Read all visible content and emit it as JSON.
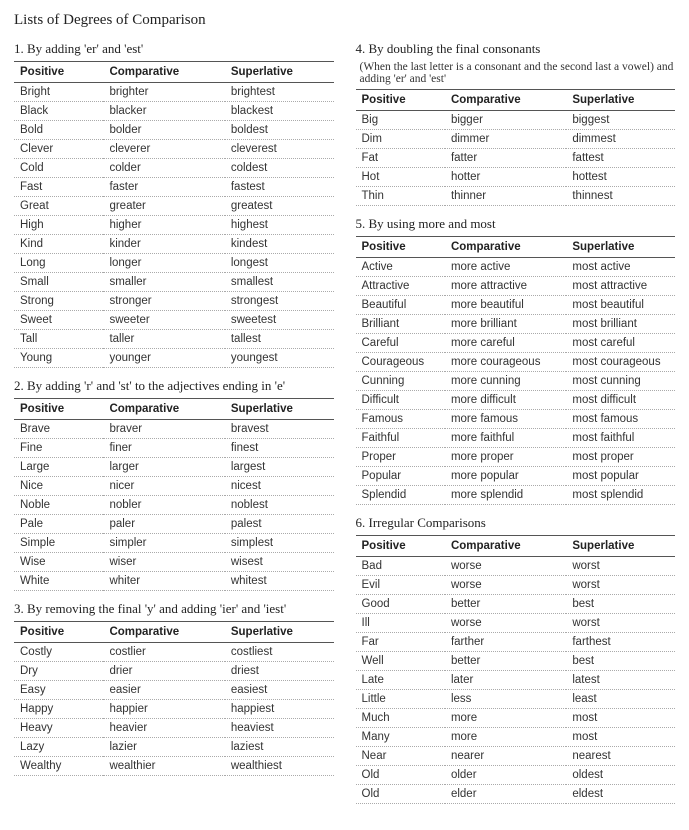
{
  "page_title": "Lists of Degrees of Comparison",
  "columns_header": {
    "positive": "Positive",
    "comparative": "Comparative",
    "superlative": "Superlative"
  },
  "sections": [
    {
      "heading": "1. By adding 'er' and 'est'",
      "rows": [
        [
          "Bright",
          "brighter",
          "brightest"
        ],
        [
          "Black",
          "blacker",
          "blackest"
        ],
        [
          "Bold",
          "bolder",
          "boldest"
        ],
        [
          "Clever",
          "cleverer",
          "cleverest"
        ],
        [
          "Cold",
          "colder",
          "coldest"
        ],
        [
          "Fast",
          "faster",
          "fastest"
        ],
        [
          "Great",
          "greater",
          "greatest"
        ],
        [
          "High",
          "higher",
          "highest"
        ],
        [
          "Kind",
          "kinder",
          "kindest"
        ],
        [
          "Long",
          "longer",
          "longest"
        ],
        [
          "Small",
          "smaller",
          "smallest"
        ],
        [
          "Strong",
          "stronger",
          "strongest"
        ],
        [
          "Sweet",
          "sweeter",
          "sweetest"
        ],
        [
          "Tall",
          "taller",
          "tallest"
        ],
        [
          "Young",
          "younger",
          "youngest"
        ]
      ]
    },
    {
      "heading": "2. By adding 'r' and 'st' to the adjectives ending in 'e'",
      "rows": [
        [
          "Brave",
          "braver",
          "bravest"
        ],
        [
          "Fine",
          "finer",
          "finest"
        ],
        [
          "Large",
          "larger",
          "largest"
        ],
        [
          "Nice",
          "nicer",
          "nicest"
        ],
        [
          "Noble",
          "nobler",
          "noblest"
        ],
        [
          "Pale",
          "paler",
          "palest"
        ],
        [
          "Simple",
          "simpler",
          "simplest"
        ],
        [
          "Wise",
          "wiser",
          "wisest"
        ],
        [
          "White",
          "whiter",
          "whitest"
        ]
      ]
    },
    {
      "heading": "3. By removing the final 'y' and adding 'ier' and 'iest'",
      "rows": [
        [
          "Costly",
          "costlier",
          "costliest"
        ],
        [
          "Dry",
          "drier",
          "driest"
        ],
        [
          "Easy",
          "easier",
          "easiest"
        ],
        [
          "Happy",
          "happier",
          "happiest"
        ],
        [
          "Heavy",
          "heavier",
          "heaviest"
        ],
        [
          "Lazy",
          "lazier",
          "laziest"
        ],
        [
          "Wealthy",
          "wealthier",
          "wealthiest"
        ]
      ]
    },
    {
      "heading": "4. By doubling the final consonants",
      "subheading": "(When the last letter is a consonant and the second last a vowel) and adding 'er' and 'est'",
      "rows": [
        [
          "Big",
          "bigger",
          "biggest"
        ],
        [
          "Dim",
          "dimmer",
          "dimmest"
        ],
        [
          "Fat",
          "fatter",
          "fattest"
        ],
        [
          "Hot",
          "hotter",
          "hottest"
        ],
        [
          "Thin",
          "thinner",
          "thinnest"
        ]
      ]
    },
    {
      "heading": "5. By using more and most",
      "rows": [
        [
          "Active",
          "more active",
          "most active"
        ],
        [
          "Attractive",
          "more attractive",
          "most attractive"
        ],
        [
          "Beautiful",
          "more beautiful",
          "most beautiful"
        ],
        [
          "Brilliant",
          "more brilliant",
          "most brilliant"
        ],
        [
          "Careful",
          "more careful",
          "most careful"
        ],
        [
          "Courageous",
          "more courageous",
          "most courageous"
        ],
        [
          "Cunning",
          "more cunning",
          "most cunning"
        ],
        [
          "Difficult",
          "more difficult",
          "most difficult"
        ],
        [
          "Famous",
          "more famous",
          "most famous"
        ],
        [
          "Faithful",
          "more faithful",
          "most faithful"
        ],
        [
          "Proper",
          "more proper",
          "most proper"
        ],
        [
          "Popular",
          "more popular",
          "most popular"
        ],
        [
          "Splendid",
          "more splendid",
          "most splendid"
        ]
      ]
    },
    {
      "heading": "6. Irregular Comparisons",
      "rows": [
        [
          "Bad",
          "worse",
          "worst"
        ],
        [
          "Evil",
          "worse",
          "worst"
        ],
        [
          "Good",
          "better",
          "best"
        ],
        [
          "Ill",
          "worse",
          "worst"
        ],
        [
          "Far",
          "farther",
          "farthest"
        ],
        [
          "Well",
          "better",
          "best"
        ],
        [
          "Late",
          "later",
          "latest"
        ],
        [
          "Little",
          "less",
          "least"
        ],
        [
          "Much",
          "more",
          "most"
        ],
        [
          "Many",
          "more",
          "most"
        ],
        [
          "Near",
          "nearer",
          "nearest"
        ],
        [
          "Old",
          "older",
          "oldest"
        ],
        [
          "Old",
          "elder",
          "eldest"
        ]
      ]
    }
  ],
  "layout": {
    "left_sections": [
      0,
      1,
      2
    ],
    "right_sections": [
      3,
      4,
      5
    ]
  }
}
